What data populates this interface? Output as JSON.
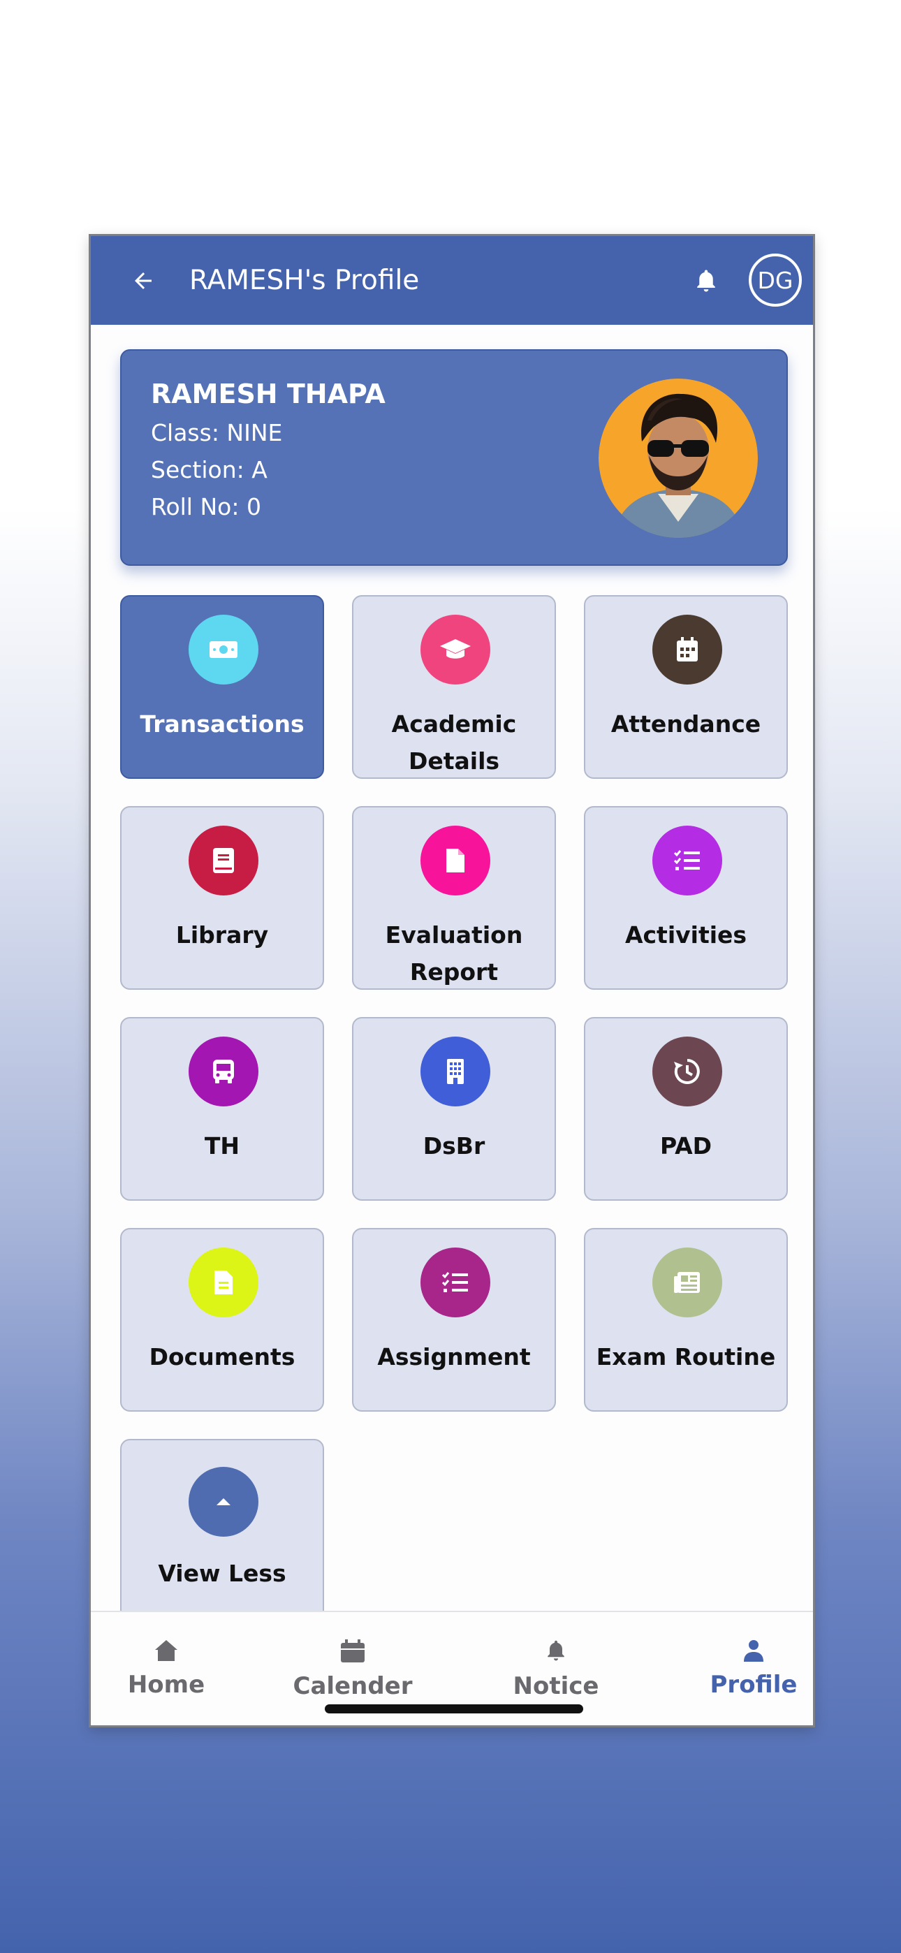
{
  "header": {
    "title": "RAMESH's Profile",
    "back_icon": "arrow-left-icon",
    "notification_icon": "bell-icon",
    "user_initials": "DG",
    "color": "#4563ac"
  },
  "student": {
    "name": "RAMESH THAPA",
    "class_line": "Class: NINE",
    "section_line": "Section: A",
    "roll_line": "Roll No: 0"
  },
  "tiles": [
    {
      "label": "Transactions",
      "icon": "money-icon",
      "color": "#5ed8f0",
      "active": true
    },
    {
      "label": "Academic Details",
      "icon": "graduation-cap-icon",
      "color": "#f0447e"
    },
    {
      "label": "Attendance",
      "icon": "calendar-icon",
      "color": "#4a3a30"
    },
    {
      "label": "Library",
      "icon": "book-icon",
      "color": "#c71d44"
    },
    {
      "label": "Evaluation Report",
      "icon": "document-icon",
      "color": "#f7139a"
    },
    {
      "label": "Activities",
      "icon": "checklist-icon",
      "color": "#b42ce3"
    },
    {
      "label": "TH",
      "icon": "bus-icon",
      "color": "#a316b2"
    },
    {
      "label": "DsBr",
      "icon": "building-icon",
      "color": "#3f5ed8"
    },
    {
      "label": "PAD",
      "icon": "history-icon",
      "color": "#6c4651"
    },
    {
      "label": "Documents",
      "icon": "file-icon",
      "color": "#dcf517"
    },
    {
      "label": "Assignment",
      "icon": "checklist-icon",
      "color": "#a8268a"
    },
    {
      "label": "Exam Routine",
      "icon": "newspaper-icon",
      "color": "#b0c08e"
    },
    {
      "label": "View Less",
      "icon": "caret-up-icon",
      "color": "#4f6cb0"
    }
  ],
  "bottom_nav": [
    {
      "label": "Home",
      "icon": "home-icon"
    },
    {
      "label": "Calender",
      "icon": "calendar-icon"
    },
    {
      "label": "Notice",
      "icon": "bell-icon"
    },
    {
      "label": "Profile",
      "icon": "person-icon",
      "active": true
    }
  ]
}
